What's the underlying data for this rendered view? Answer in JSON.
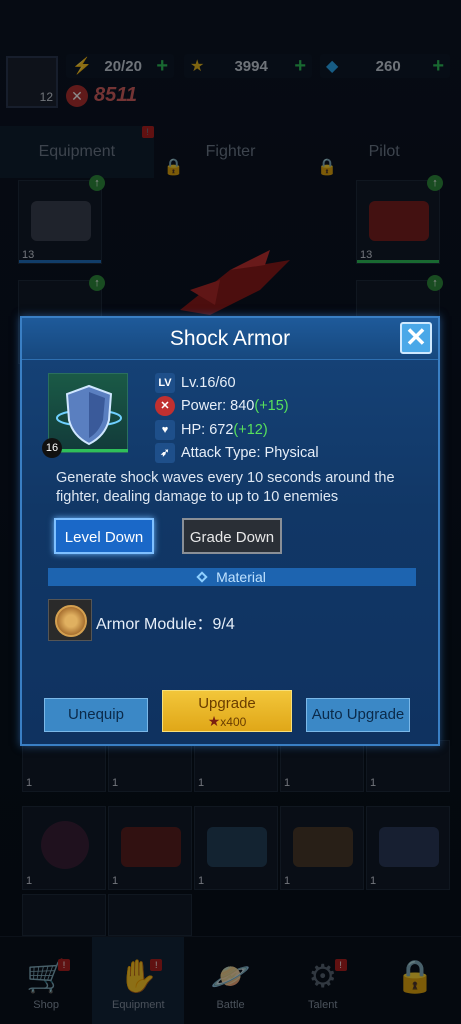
{
  "header": {
    "player_level": "12",
    "energy": "20/20",
    "stars": "3994",
    "gems": "260",
    "power": "8511"
  },
  "tabs": [
    {
      "label": "Equipment",
      "badge": "!"
    },
    {
      "label": "Fighter"
    },
    {
      "label": "Pilot"
    }
  ],
  "slots": {
    "top_left_count": "13",
    "top_right_count": "13",
    "row_counts": [
      "1",
      "1",
      "1",
      "1",
      "1"
    ]
  },
  "dialog": {
    "title": "Shock Armor",
    "close_label": "✕",
    "item_level_badge": "16",
    "stats": {
      "level": "Lv.16/60",
      "power_label": "Power: 840",
      "power_bonus": "(+15)",
      "hp_label": "HP: 672",
      "hp_bonus": "(+12)",
      "attack_type": "Attack Type: Physical"
    },
    "description": "Generate shock waves every 10 seconds around the fighter, dealing damage to up to 10 enemies",
    "level_down_label": "Level Down",
    "grade_down_label": "Grade Down",
    "material_header": "Material",
    "material_name": "Armor Module",
    "material_count": "9/4",
    "unequip_label": "Unequip",
    "upgrade_label": "Upgrade",
    "upgrade_cost": "x400",
    "auto_upgrade_label": "Auto Upgrade"
  },
  "nav": [
    {
      "label": "Shop",
      "icon": "shop-cart-icon",
      "badge": "!"
    },
    {
      "label": "Equipment",
      "icon": "equipment-hand-icon",
      "badge": "!"
    },
    {
      "label": "Battle",
      "icon": "planet-icon"
    },
    {
      "label": "Talent",
      "icon": "gear-rocket-icon",
      "badge": "!"
    },
    {
      "label": "",
      "icon": "lock-icon"
    }
  ],
  "colors": {
    "dialog_bg": "#113766",
    "dialog_border": "#3a7fc4",
    "bonus_green": "#57e05c",
    "upgrade_gold": "#f2c63a",
    "power_red": "#d46060"
  }
}
